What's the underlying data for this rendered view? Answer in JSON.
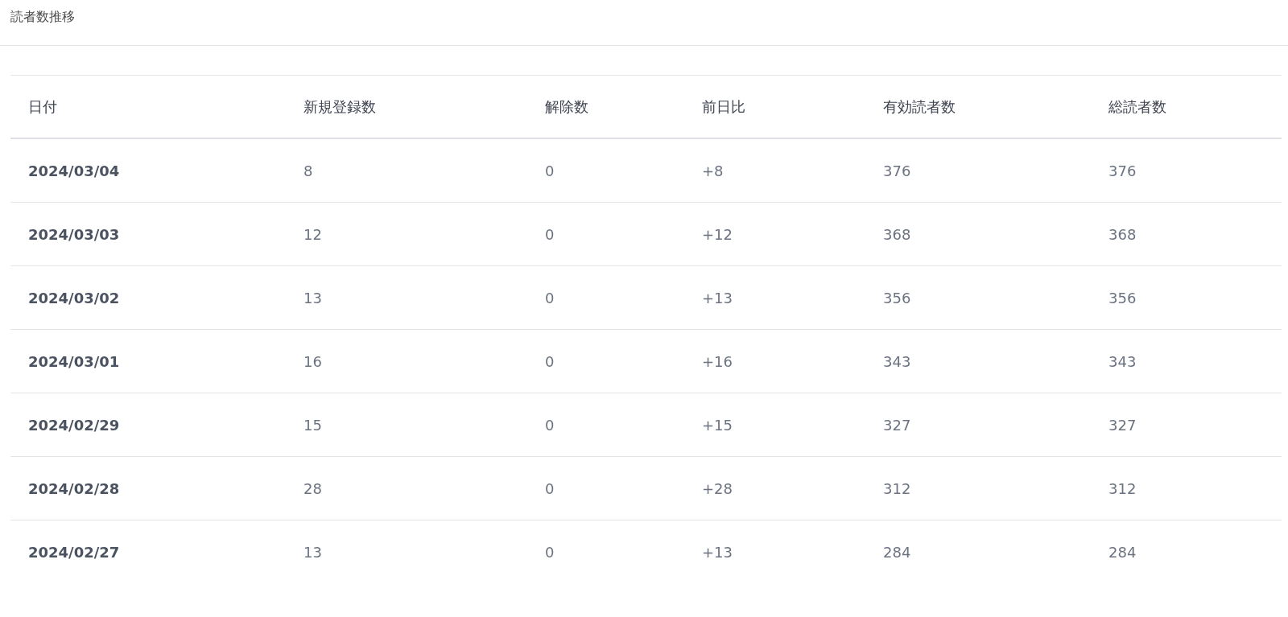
{
  "title": "読者数推移",
  "table": {
    "columns": [
      "日付",
      "新規登録数",
      "解除数",
      "前日比",
      "有効読者数",
      "総読者数"
    ],
    "rows": [
      [
        "2024/03/04",
        "8",
        "0",
        "+8",
        "376",
        "376"
      ],
      [
        "2024/03/03",
        "12",
        "0",
        "+12",
        "368",
        "368"
      ],
      [
        "2024/03/02",
        "13",
        "0",
        "+13",
        "356",
        "356"
      ],
      [
        "2024/03/01",
        "16",
        "0",
        "+16",
        "343",
        "343"
      ],
      [
        "2024/02/29",
        "15",
        "0",
        "+15",
        "327",
        "327"
      ],
      [
        "2024/02/28",
        "28",
        "0",
        "+28",
        "312",
        "312"
      ],
      [
        "2024/02/27",
        "13",
        "0",
        "+13",
        "284",
        "284"
      ]
    ]
  }
}
